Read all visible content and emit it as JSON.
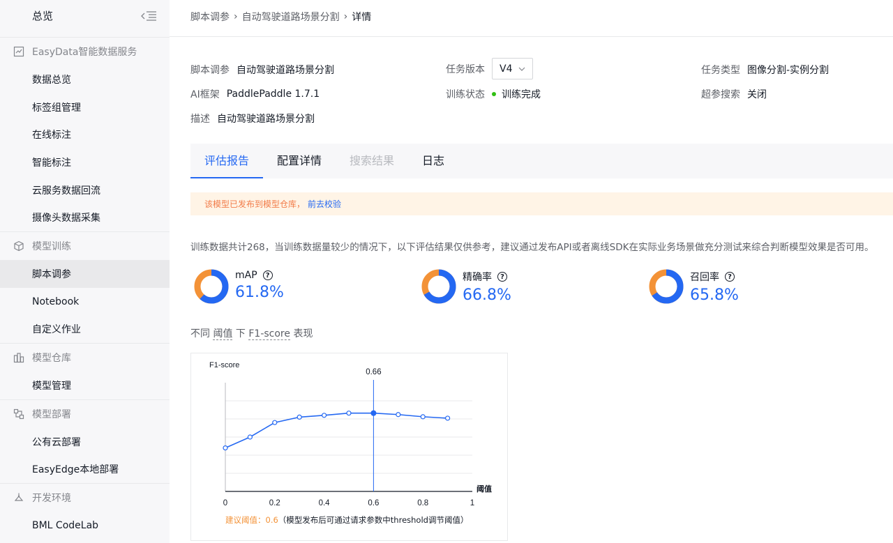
{
  "sidebar": {
    "top_title": "总览",
    "groups": [
      {
        "title": "EasyData智能数据服务",
        "items": [
          "数据总览",
          "标签组管理",
          "在线标注",
          "智能标注",
          "云服务数据回流",
          "摄像头数据采集"
        ]
      },
      {
        "title": "模型训练",
        "items": [
          "脚本调参",
          "Notebook",
          "自定义作业"
        ]
      },
      {
        "title": "模型仓库",
        "items": [
          "模型管理"
        ]
      },
      {
        "title": "模型部署",
        "items": [
          "公有云部署",
          "EasyEdge本地部署"
        ]
      },
      {
        "title": "开发环境",
        "items": [
          "BML CodeLab"
        ]
      }
    ]
  },
  "breadcrumb": [
    "脚本调参",
    "自动驾驶道路场景分割",
    "详情"
  ],
  "info": {
    "script_tuning": {
      "key": "脚本调参",
      "value": "自动驾驶道路场景分割"
    },
    "task_version": {
      "key": "任务版本",
      "value": "V4"
    },
    "task_type": {
      "key": "任务类型",
      "value": "图像分割-实例分割"
    },
    "ai_framework": {
      "key": "AI框架",
      "value": "PaddlePaddle 1.7.1"
    },
    "training_status": {
      "key": "训练状态",
      "value": "训练完成"
    },
    "hyperparam_search": {
      "key": "超参搜索",
      "value": "关闭"
    },
    "description": {
      "key": "描述",
      "value": "自动驾驶道路场景分割"
    }
  },
  "tabs": [
    "评估报告",
    "配置详情",
    "搜索结果",
    "日志"
  ],
  "notice": {
    "text": "该模型已发布到模型仓库，",
    "link": "前去校验"
  },
  "eval": {
    "description": "训练数据共计268，当训练数据量较少的情况下，以下评估结果仅供参考，建议通过发布API或者离线SDK在实际业务场景做充分测试来综合判断模型效果是否可用。"
  },
  "metrics": [
    {
      "label": "mAP",
      "value": "61.8%",
      "fraction": 0.618
    },
    {
      "label": "精确率",
      "value": "66.8%",
      "fraction": 0.668
    },
    {
      "label": "召回率",
      "value": "65.8%",
      "fraction": 0.658
    }
  ],
  "colors": {
    "primary": "#2468f2",
    "remainder": "#f39237",
    "success": "#30bf13"
  },
  "chart_heading": {
    "p1": "不同",
    "p2": "阈值",
    "p3": "下",
    "p4": "F1-score",
    "p5": "表现"
  },
  "suggest": {
    "label": "建议阈值：",
    "value": "0.6",
    "note": "（模型发布后可通过请求参数中threshold调节阈值）"
  },
  "chart_data": {
    "type": "line",
    "ylabel": "F1-score",
    "xlabel": "阈值",
    "xlim": [
      0,
      1
    ],
    "x_ticks": [
      "0",
      "0.2",
      "0.4",
      "0.6",
      "0.8",
      "1"
    ],
    "grid": true,
    "series": [
      {
        "x": [
          0,
          0.1,
          0.2,
          0.3,
          0.4,
          0.5,
          0.6,
          0.7,
          0.8,
          0.9
        ],
        "y": [
          0.57,
          0.6,
          0.64,
          0.655,
          0.66,
          0.666,
          0.666,
          0.662,
          0.656,
          0.652
        ]
      }
    ],
    "highlight": {
      "x": 0.6,
      "label": "0.66"
    }
  }
}
